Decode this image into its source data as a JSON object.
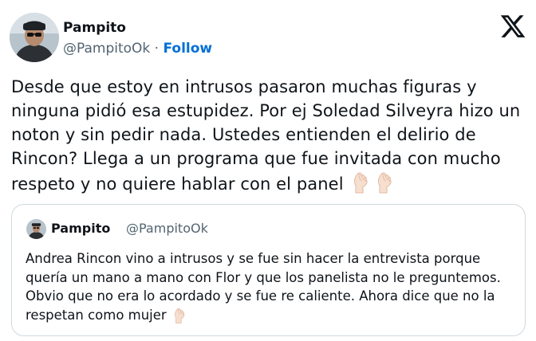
{
  "author": {
    "name": "Pampito",
    "handle": "@PampitoOk",
    "separator": " · ",
    "follow_label": "Follow"
  },
  "tweet": {
    "text": "Desde que estoy en intrusos pasaron muchas figuras y ninguna pidió esa estupidez. Por ej Soledad Silveyra hizo un noton y sin pedir nada. Ustedes entienden el delirio de Rincon? Llega a un programa que fue invitada con mucho respeto y no quiere hablar con el panel ",
    "trailing_emoji": "pinched-fingers-emoji"
  },
  "quoted_tweet": {
    "name": "Pampito",
    "handle": "@PampitoOk",
    "text": "Andrea Rincon vino a intrusos y se fue sin hacer la entrevista porque quería un mano a mano con Flor y que los panelista no le preguntemos. Obvio que no era lo acordado y se fue re caliente. Ahora dice que no la respetan como mujer ",
    "trailing_emoji": "pinched-fingers-emoji"
  },
  "icons": {
    "logo": "x-logo-icon",
    "emoji": "pinched-fingers-emoji"
  },
  "colors": {
    "text": "#0f1419",
    "secondary": "#536471",
    "link": "#006fd6",
    "border": "#cfd9de"
  }
}
